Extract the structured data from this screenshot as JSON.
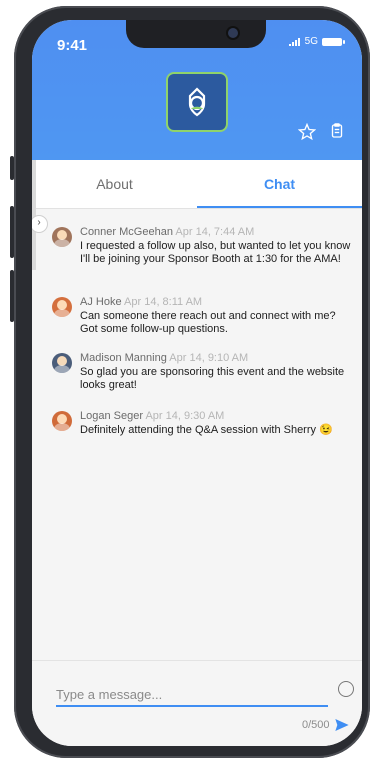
{
  "status": {
    "time": "9:41",
    "network": "5G"
  },
  "header": {
    "app_icon": "shield-gear-logo",
    "favorite_icon": "star-icon",
    "notes_icon": "clipboard-icon"
  },
  "tabs": [
    {
      "label": "About"
    },
    {
      "label": "Chat"
    }
  ],
  "messages": [
    {
      "name": "Conner McGeehan",
      "time": "Apr 14, 7:44 AM",
      "text": "I requested a follow up also, but wanted to let you know I'll be joining your Sponsor Booth at 1:30 for the AMA!",
      "avatar_color": "#a0745b"
    },
    {
      "name": "AJ Hoke",
      "time": "Apr 14, 8:11 AM",
      "text": "Can someone there reach out and connect with me? Got some follow-up questions.",
      "avatar_color": "#d46f3d"
    },
    {
      "name": "Madison Manning",
      "time": "Apr 14, 9:10 AM",
      "text": "So glad you are sponsoring this event and the website looks great!",
      "avatar_color": "#4b5d7a"
    },
    {
      "name": "Logan Seger",
      "time": "Apr 14, 9:30 AM",
      "text": "Definitely attending the Q&A session with Sherry 😉",
      "avatar_color": "#d06b3a"
    }
  ],
  "composer": {
    "placeholder": "Type a message...",
    "counter": "0/500",
    "emoji_icon": "smile-icon",
    "send_icon": "send-icon"
  },
  "colors": {
    "header_blue": "#4f91f1",
    "accent_blue": "#3f8ef3",
    "logo_green": "#8fd36b"
  }
}
